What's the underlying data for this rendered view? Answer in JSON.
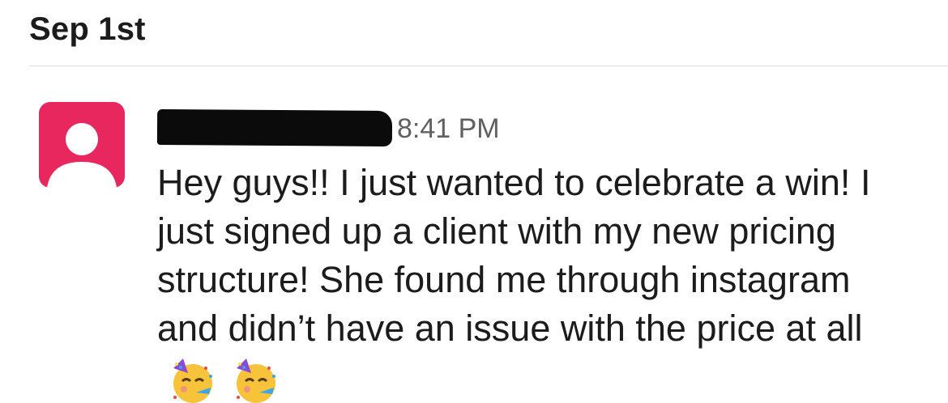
{
  "date_header": "Sep 1st",
  "message": {
    "timestamp": "8:41 PM",
    "text": "Hey guys!! I just wanted to celebrate a win! I just signed up a client with my new pricing structure! She found me through instagram and didn’t have an issue with the price at all",
    "emoji": [
      "partying-face-emoji",
      "partying-face-emoji"
    ]
  },
  "colors": {
    "avatar_bg": "#e8275f",
    "timestamp": "#616061",
    "text": "#1d1c1d",
    "divider": "#dddddd"
  }
}
